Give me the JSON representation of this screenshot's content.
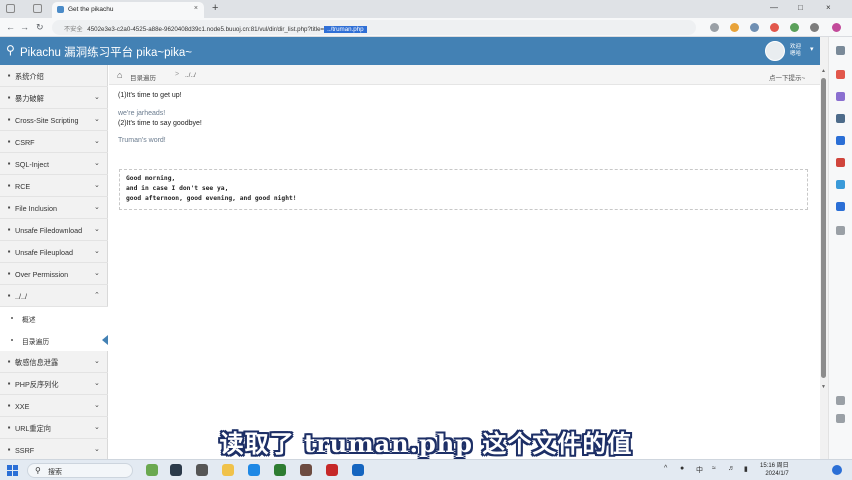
{
  "browser": {
    "tab_title": "Get the pikachu",
    "tab_close": "×",
    "new_tab": "+",
    "window_controls": [
      "—",
      "□",
      "×"
    ],
    "nav": {
      "back": "←",
      "forward": "→",
      "reload": "↻"
    },
    "url": {
      "insecure_label": "不安全",
      "address": "4502e3e3-c2a0-4525-a88e-9620408d39c1.node5.buuoj.cn:81/vul/dir/dir_list.php?title=",
      "param": "../truman.php"
    }
  },
  "header": {
    "logo_icon": "magnifier-icon",
    "title": "Pikachu 漏洞练习平台 pika~pika~",
    "user_line1": "欢迎",
    "user_line2": "嗯哈",
    "caret": "▾"
  },
  "sidebar": {
    "items": [
      {
        "label": "系统介绍",
        "icon": "▪",
        "chevron": ""
      },
      {
        "label": "暴力破解",
        "icon": "▪",
        "chevron": "⌄"
      },
      {
        "label": "Cross-Site Scripting",
        "icon": "▪",
        "chevron": "⌄"
      },
      {
        "label": "CSRF",
        "icon": "▪",
        "chevron": "⌄"
      },
      {
        "label": "SQL-Inject",
        "icon": "▪",
        "chevron": "⌄"
      },
      {
        "label": "RCE",
        "icon": "▪",
        "chevron": "⌄"
      },
      {
        "label": "File Inclusion",
        "icon": "▪",
        "chevron": "⌄"
      },
      {
        "label": "Unsafe Filedownload",
        "icon": "▪",
        "chevron": "⌄"
      },
      {
        "label": "Unsafe Fileupload",
        "icon": "▪",
        "chevron": "⌄"
      },
      {
        "label": "Over Permission",
        "icon": "▪",
        "chevron": "⌄"
      },
      {
        "label": "../../",
        "icon": "▪",
        "chevron": "⌃"
      }
    ],
    "subitems": [
      {
        "label": "概述"
      },
      {
        "label": "目录遍历"
      }
    ],
    "items_after": [
      {
        "label": "敏感信息泄露",
        "icon": "▪",
        "chevron": "⌄"
      },
      {
        "label": "PHP反序列化",
        "icon": "▪",
        "chevron": "⌄"
      },
      {
        "label": "XXE",
        "icon": "▪",
        "chevron": "⌄"
      },
      {
        "label": "URL重定向",
        "icon": "▪",
        "chevron": "⌄"
      },
      {
        "label": "SSRF",
        "icon": "▪",
        "chevron": "⌄"
      }
    ]
  },
  "breadcrumb": {
    "home": "目录遍历",
    "separator": ">",
    "current": "../../",
    "hint": "点一下提示~"
  },
  "content": {
    "line1": "(1)It's time to get up!",
    "line2": "we're jarheads!",
    "line3": "(2)It's time to say goodbye!",
    "line4": "Truman's word!",
    "code": [
      "Good morning,",
      "and in case I don't see ya,",
      "good afternoon, good evening, and good night!"
    ]
  },
  "subtitle": "读取了 truman.php 这个文件的值",
  "taskbar": {
    "search_placeholder": "搜索",
    "clock_time": "15:16 周日",
    "clock_date": "2024/1/7"
  },
  "colors": {
    "header": "#4381b4",
    "sidebar": "#f2f2f2",
    "url_highlight": "#2f6fd6"
  }
}
